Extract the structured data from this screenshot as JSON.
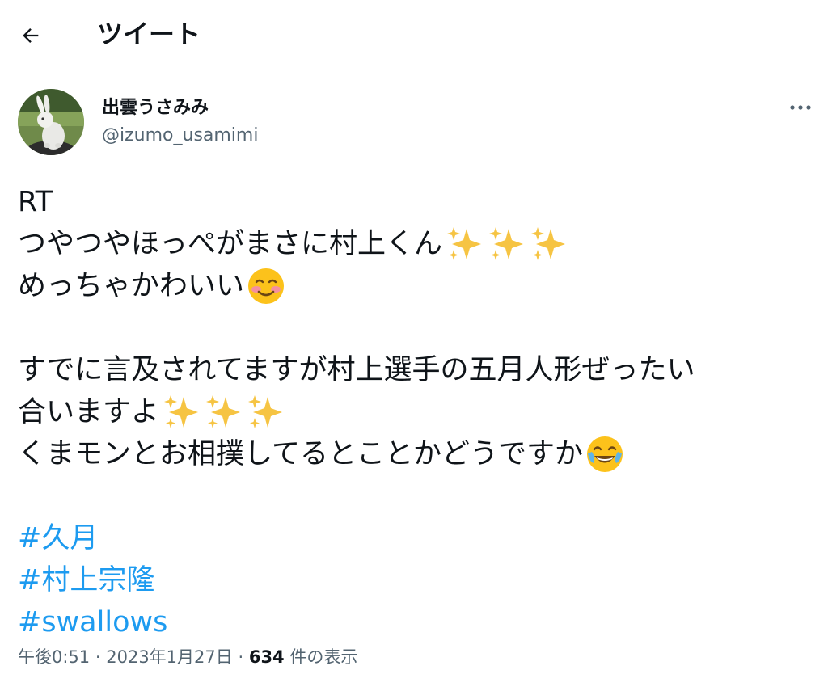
{
  "header": {
    "back_icon": "arrow-left-icon",
    "title": "ツイート"
  },
  "author": {
    "display_name": "出雲うさみみ",
    "handle": "@izumo_usamimi",
    "avatar": "white-rabbit-figurine-photo",
    "more_icon": "more-horizontal-icon"
  },
  "tweet": {
    "line1": "RT",
    "line2": "つやつやほっぺがまさに村上くん",
    "line2_emojis": [
      "sparkles",
      "sparkles",
      "sparkles"
    ],
    "line3": "めっちゃかわいい",
    "line3_emojis": [
      "smiling-face-with-blush"
    ],
    "line4": "すでに言及されてますが村上選手の五月人形ぜったい",
    "line5": "合いますよ",
    "line5_emojis": [
      "sparkles",
      "sparkles",
      "sparkles"
    ],
    "line6": "くまモンとお相撲してるとことかどうですか",
    "line6_emojis": [
      "face-with-tears-of-joy"
    ],
    "hashtags": [
      "#久月",
      "#村上宗隆",
      "#swallows"
    ]
  },
  "meta": {
    "time": "午後0:51",
    "separator": "·",
    "date": "2023年1月27日",
    "views_count": "634",
    "views_label": "件の表示"
  },
  "colors": {
    "text": "#0f1419",
    "secondary": "#536471",
    "link": "#1d9bf0"
  }
}
